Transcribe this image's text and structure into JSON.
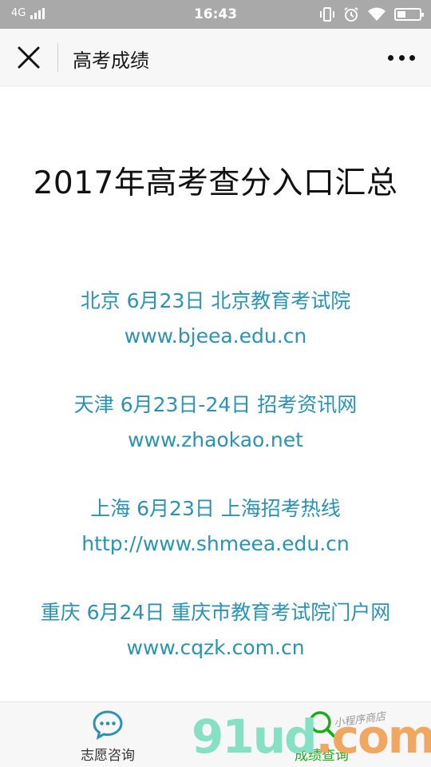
{
  "status_bar": {
    "network": "4G",
    "time": "16:43",
    "battery_level": 0.4
  },
  "header": {
    "title": "高考成绩",
    "icons": {
      "close": "close-icon",
      "more": "more-icon"
    }
  },
  "content": {
    "heading": "2017年高考查分入口汇总",
    "link_color": "#2a93b4",
    "entries": [
      {
        "line1": "北京 6月23日 北京教育考试院",
        "line2": "www.bjeea.edu.cn"
      },
      {
        "line1": "天津 6月23日-24日 招考资讯网",
        "line2": "www.zhaokao.net"
      },
      {
        "line1": "上海 6月23日 上海招考热线",
        "line2": "http://www.shmeea.edu.cn"
      },
      {
        "line1": "重庆 6月24日 重庆市教育考试院门户网",
        "line2": "www.cqzk.com.cn"
      }
    ]
  },
  "tabbar": {
    "tabs": [
      {
        "label": "志愿咨询",
        "icon": "chat-bubble-icon",
        "active": false
      },
      {
        "label": "成绩查询",
        "icon": "search-icon",
        "active": true
      }
    ],
    "active_color": "#1aad19"
  },
  "watermark": {
    "main_text": "91ud",
    "suffix": ".com",
    "small_text": "小程序商店"
  }
}
